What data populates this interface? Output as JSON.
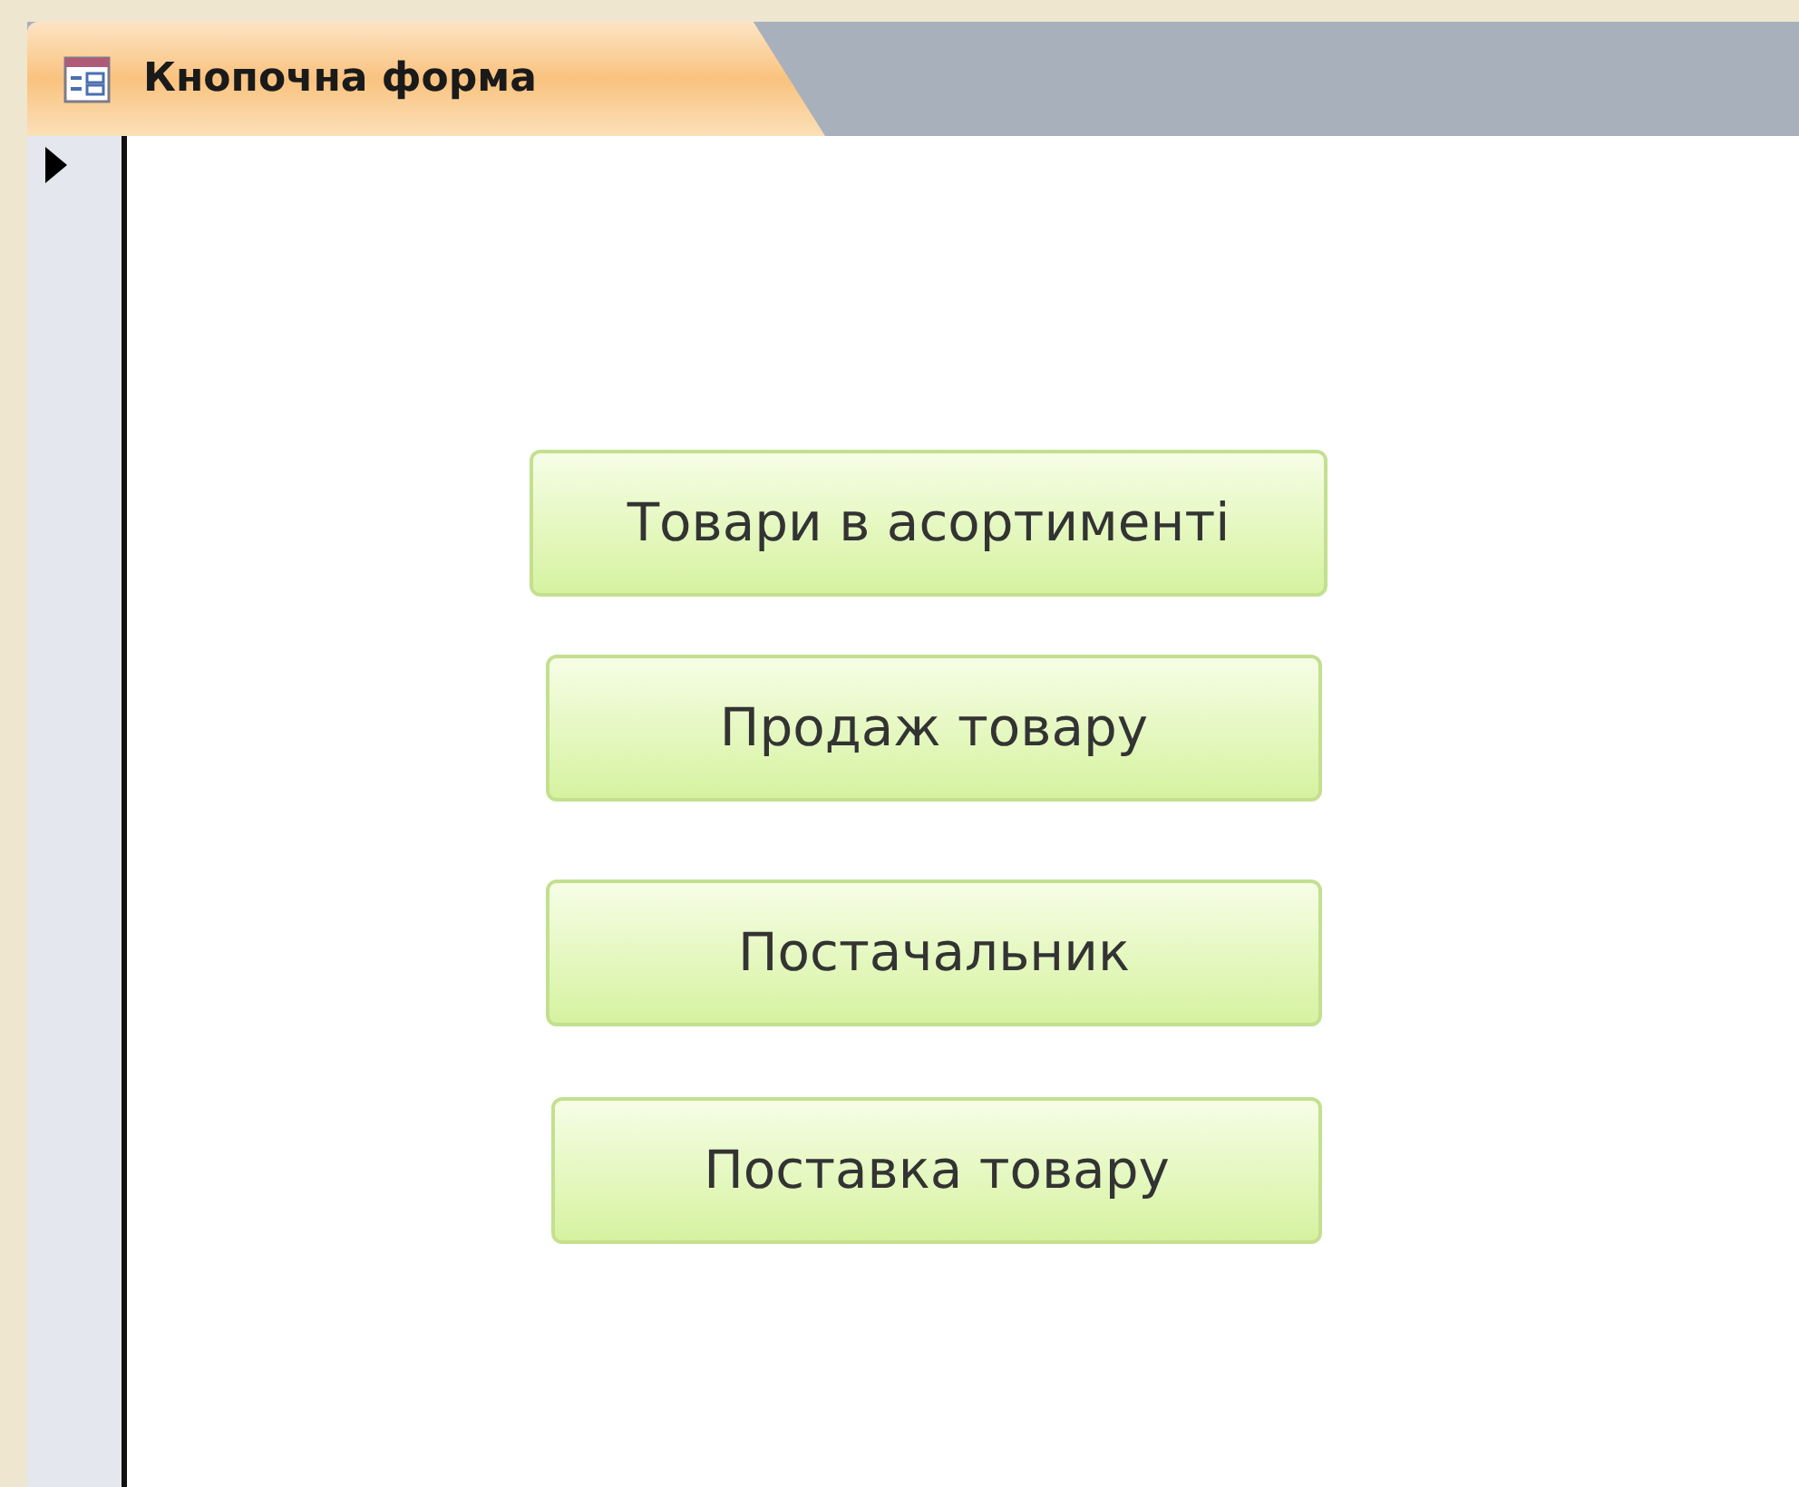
{
  "tab": {
    "title": "Кнопочна форма",
    "selected": true
  },
  "buttons": [
    {
      "label": "Товари в асортименті"
    },
    {
      "label": "Продаж товару"
    },
    {
      "label": "Постачальник"
    },
    {
      "label": "Поставка товару"
    }
  ]
}
